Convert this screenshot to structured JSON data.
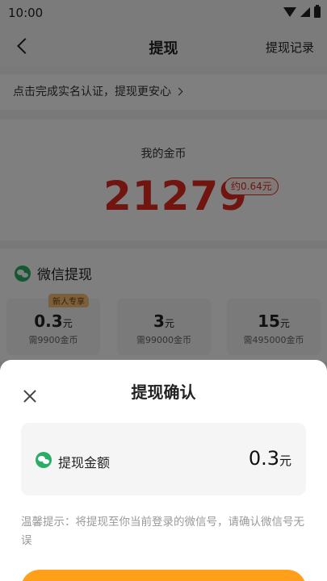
{
  "status_bar": {
    "time": "10:00"
  },
  "nav": {
    "title": "提现",
    "right": "提现记录"
  },
  "verify_banner": {
    "text": "点击完成实名认证，提现更安心"
  },
  "coins": {
    "label": "我的金币",
    "value": "21279",
    "approx": "约0.64元"
  },
  "wechat_section": {
    "title": "微信提现",
    "options": [
      {
        "amount": "0.3",
        "unit": "元",
        "need": "需9900金币",
        "tag": "新人专享"
      },
      {
        "amount": "3",
        "unit": "元",
        "need": "需99000金币"
      },
      {
        "amount": "15",
        "unit": "元",
        "need": "需495000金币"
      }
    ]
  },
  "dialog": {
    "title": "提现确认",
    "amount_label": "提现金额",
    "amount_value": "0.3",
    "amount_unit": "元",
    "tip": "温馨提示：将提现至你当前登录的微信号，请确认微信号无误"
  },
  "colors": {
    "accent_red": "#e02b1e",
    "wechat_green": "#2aae67",
    "button_orange": "#ff9f1a"
  },
  "icons": [
    "back-arrow-icon",
    "wifi-icon",
    "signal-icon",
    "battery-icon",
    "chevron-right-icon",
    "wechat-icon",
    "close-icon"
  ]
}
